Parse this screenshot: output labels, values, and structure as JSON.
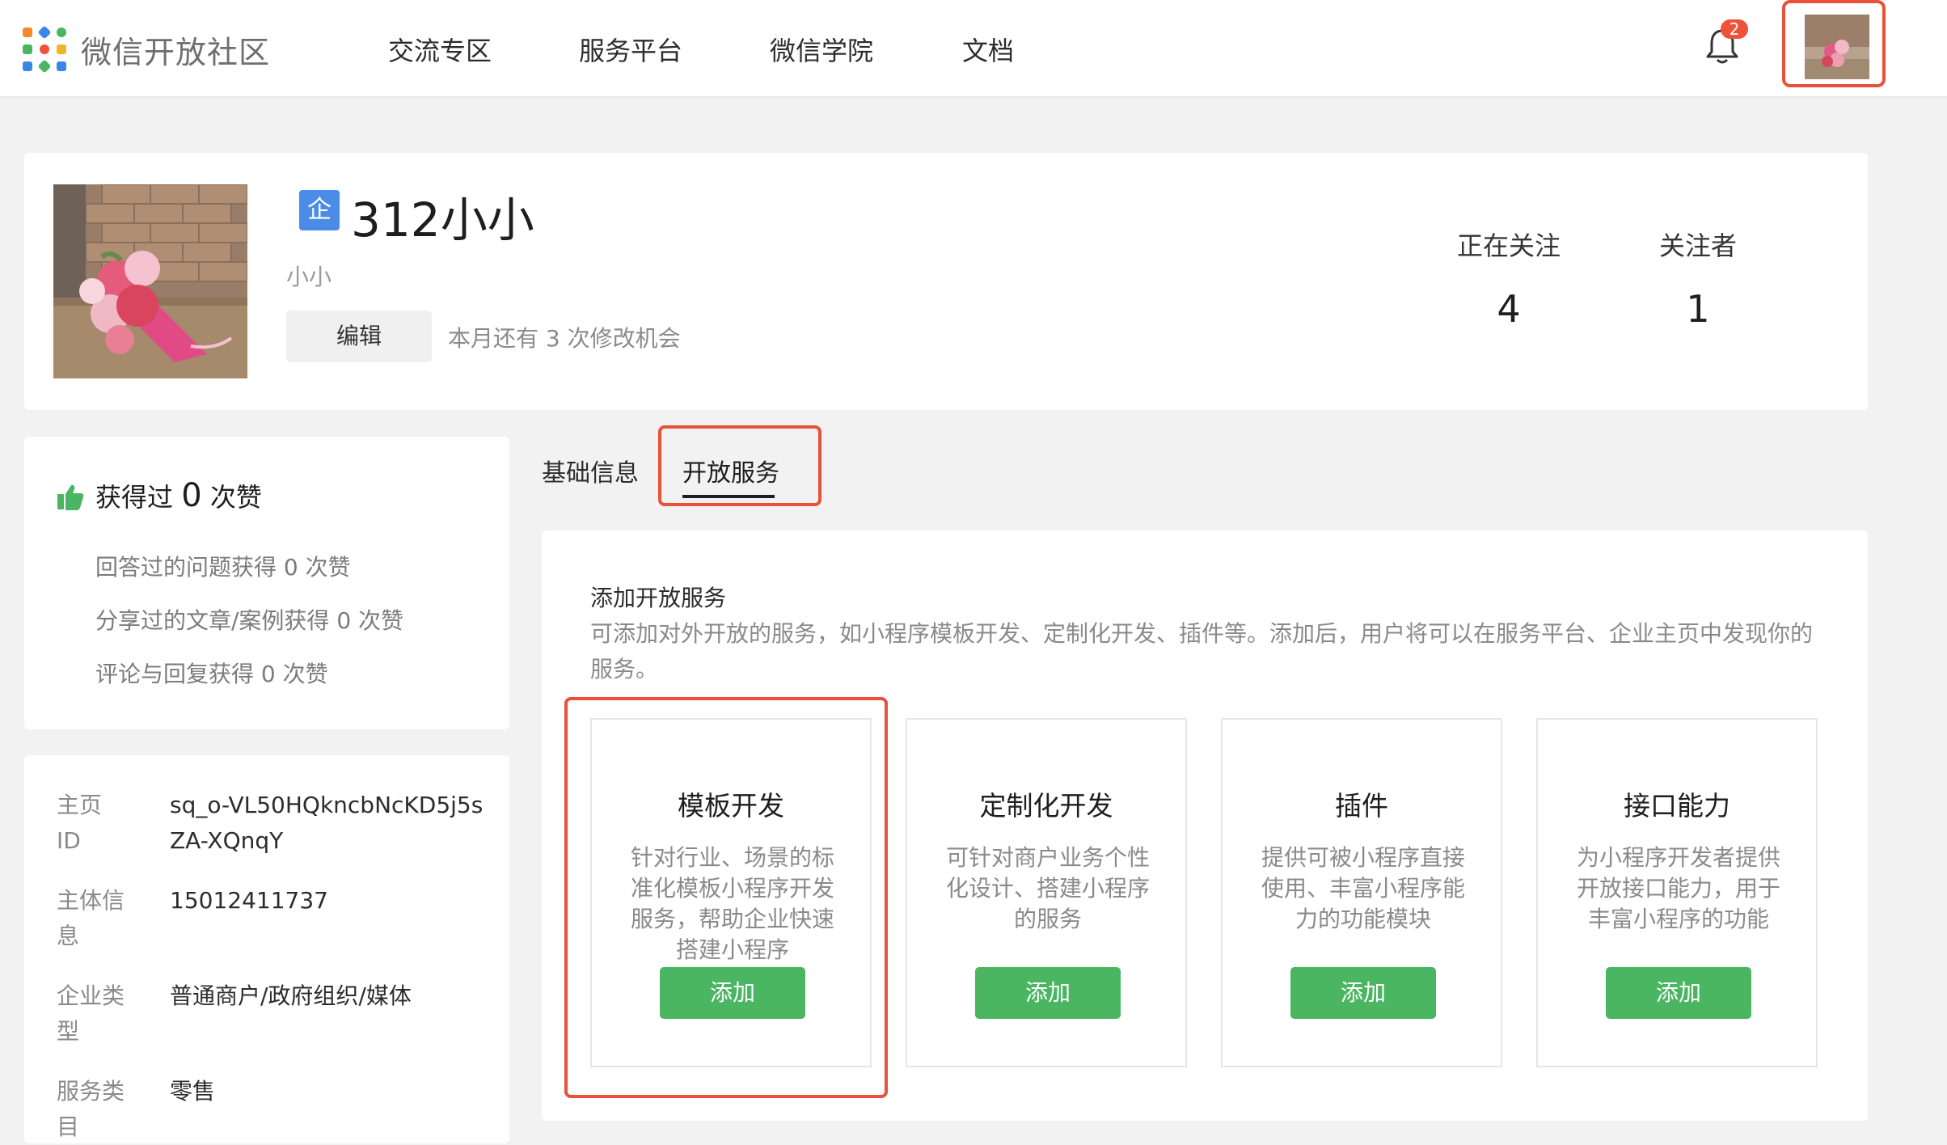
{
  "app": {
    "logo_text": "微信开放社区"
  },
  "nav": {
    "items": [
      "交流专区",
      "服务平台",
      "微信学院",
      "文档"
    ]
  },
  "notifications": {
    "count": "2"
  },
  "profile": {
    "enterprise_badge": "企",
    "name": "312小小",
    "nickname": "小小",
    "edit_label": "编辑",
    "edit_hint": "本月还有 3 次修改机会",
    "stats": [
      {
        "label": "正在关注",
        "value": "4"
      },
      {
        "label": "关注者",
        "value": "1"
      }
    ]
  },
  "likes": {
    "title_prefix": "获得过",
    "count": "0",
    "title_suffix": "次赞",
    "rows": [
      "回答过的问题获得 0 次赞",
      "分享过的文章/案例获得 0 次赞",
      "评论与回复获得 0 次赞"
    ]
  },
  "info": [
    {
      "label": "主页　ID",
      "value": "sq_o-VL50HQkncbNcKD5j5sZA-XQnqY"
    },
    {
      "label": "主体信息",
      "value": "15012411737"
    },
    {
      "label": "企业类型",
      "value": "普通商户/政府组织/媒体"
    },
    {
      "label": "服务类目",
      "value": "零售"
    }
  ],
  "tabs": [
    {
      "label": "基础信息",
      "active": false
    },
    {
      "label": "开放服务",
      "active": true
    }
  ],
  "services": {
    "title": "添加开放服务",
    "description": "可添加对外开放的服务，如小程序模板开发、定制化开发、插件等。添加后，用户将可以在服务平台、企业主页中发现你的服务。",
    "cards": [
      {
        "title": "模板开发",
        "desc": "针对行业、场景的标准化模板小程序开发服务，帮助企业快速搭建小程序",
        "button": "添加"
      },
      {
        "title": "定制化开发",
        "desc": "可针对商户业务个性化设计、搭建小程序的服务",
        "button": "添加"
      },
      {
        "title": "插件",
        "desc": "提供可被小程序直接使用、丰富小程序能力的功能模块",
        "button": "添加"
      },
      {
        "title": "接口能力",
        "desc": "为小程序开发者提供开放接口能力，用于丰富小程序的功能",
        "button": "添加"
      }
    ]
  },
  "colors": {
    "accent_green": "#4ab662",
    "highlight_red": "#e8513a",
    "badge_blue": "#4b8ce6"
  }
}
